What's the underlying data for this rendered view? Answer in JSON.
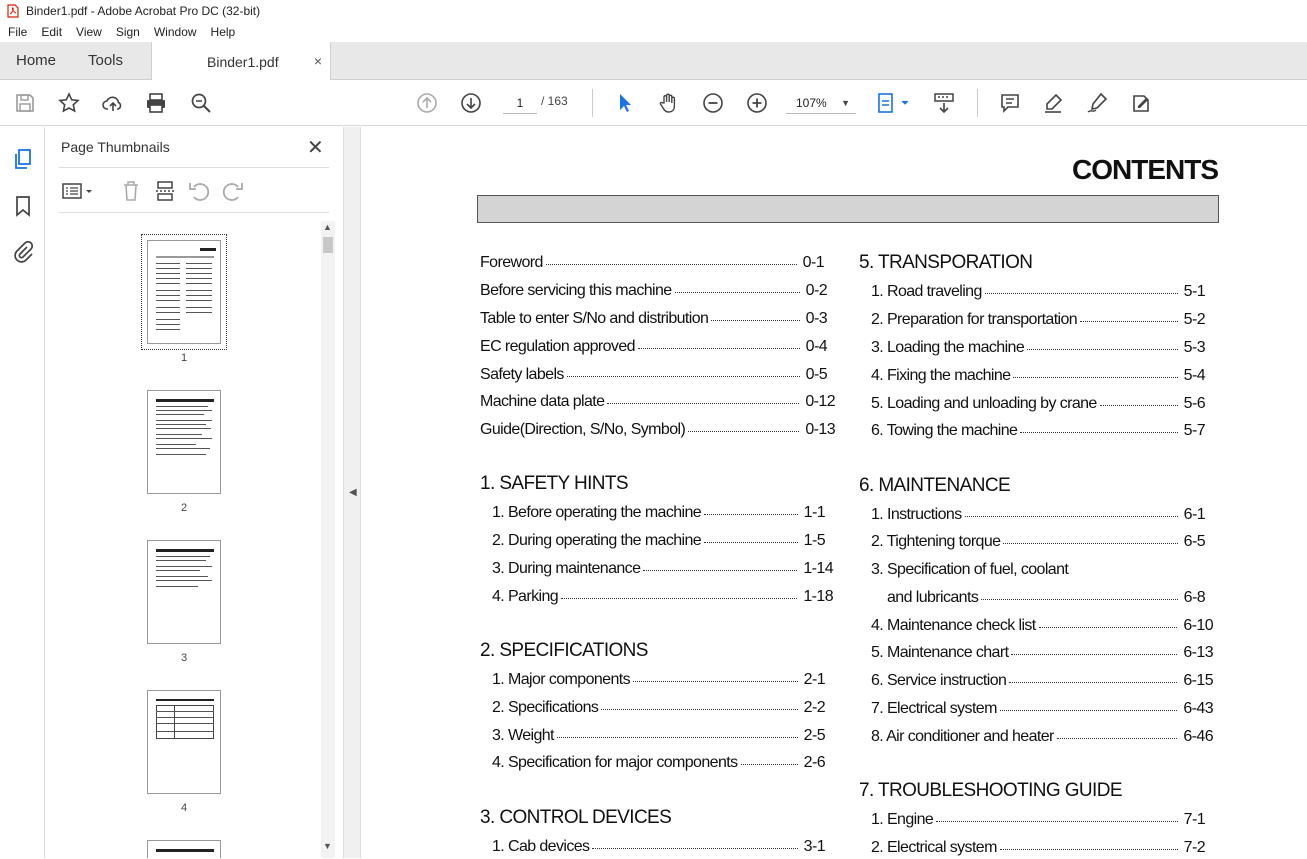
{
  "window": {
    "title": "Binder1.pdf - Adobe Acrobat Pro DC (32-bit)"
  },
  "menu": [
    "File",
    "Edit",
    "View",
    "Sign",
    "Window",
    "Help"
  ],
  "tabs": {
    "home": "Home",
    "tools": "Tools",
    "document": "Binder1.pdf",
    "close": "×"
  },
  "toolbar": {
    "page_current": "1",
    "page_total": "/ 163",
    "zoom": "107%"
  },
  "thumbnails_panel": {
    "title": "Page Thumbnails",
    "close": "✕",
    "pages": [
      "1",
      "2",
      "3",
      "4"
    ]
  },
  "document": {
    "heading": "CONTENTS",
    "left_top": [
      {
        "title": "Foreword",
        "page": "0-1"
      },
      {
        "title": "Before servicing this machine",
        "page": "0-2"
      },
      {
        "title": "Table to enter S/No and distribution",
        "page": "0-3"
      },
      {
        "title": "EC regulation approved",
        "page": "0-4"
      },
      {
        "title": "Safety labels",
        "page": "0-5"
      },
      {
        "title": "Machine data plate",
        "page": "0-12"
      },
      {
        "title": "Guide(Direction, S/No, Symbol)",
        "page": "0-13"
      }
    ],
    "sec1": {
      "title": "1. SAFETY HINTS",
      "items": [
        {
          "title": "1. Before operating the machine",
          "page": "1-1"
        },
        {
          "title": "2. During operating the machine",
          "page": "1-5"
        },
        {
          "title": "3. During maintenance",
          "page": "1-14"
        },
        {
          "title": "4. Parking",
          "page": "1-18"
        }
      ]
    },
    "sec2": {
      "title": "2. SPECIFICATIONS",
      "items": [
        {
          "title": "1. Major components",
          "page": "2-1"
        },
        {
          "title": "2. Specifications",
          "page": "2-2"
        },
        {
          "title": "3. Weight",
          "page": "2-5"
        },
        {
          "title": "4. Specification for major components",
          "page": "2-6"
        }
      ]
    },
    "sec3": {
      "title": "3. CONTROL DEVICES",
      "items": [
        {
          "title": "1. Cab devices",
          "page": "3-1"
        }
      ]
    },
    "sec5": {
      "title": "5. TRANSPORATION",
      "items": [
        {
          "title": "1. Road traveling",
          "page": "5-1"
        },
        {
          "title": "2. Preparation for transportation",
          "page": "5-2"
        },
        {
          "title": "3. Loading the machine",
          "page": "5-3"
        },
        {
          "title": "4. Fixing the machine",
          "page": "5-4"
        },
        {
          "title": "5. Loading and unloading by crane",
          "page": "5-6"
        },
        {
          "title": "6. Towing the machine",
          "page": "5-7"
        }
      ]
    },
    "sec6": {
      "title": "6. MAINTENANCE",
      "items": [
        {
          "title": "1. Instructions",
          "page": "6-1"
        },
        {
          "title": "2. Tightening torque",
          "page": "6-5"
        },
        {
          "title": "3. Specification of fuel, coolant",
          "page": ""
        },
        {
          "title": "and lubricants",
          "page": "6-8"
        },
        {
          "title": "4. Maintenance check list",
          "page": "6-10"
        },
        {
          "title": "5. Maintenance chart",
          "page": "6-13"
        },
        {
          "title": "6. Service instruction",
          "page": "6-15"
        },
        {
          "title": "7. Electrical system",
          "page": "6-43"
        },
        {
          "title": "8. Air conditioner and heater",
          "page": "6-46"
        }
      ]
    },
    "sec7": {
      "title": "7. TROUBLESHOOTING GUIDE",
      "items": [
        {
          "title": "1. Engine",
          "page": "7-1"
        },
        {
          "title": "2. Electrical system",
          "page": "7-2"
        }
      ]
    }
  },
  "colors": {
    "accent": "#1a73e8",
    "pdf_red": "#d81e05"
  }
}
